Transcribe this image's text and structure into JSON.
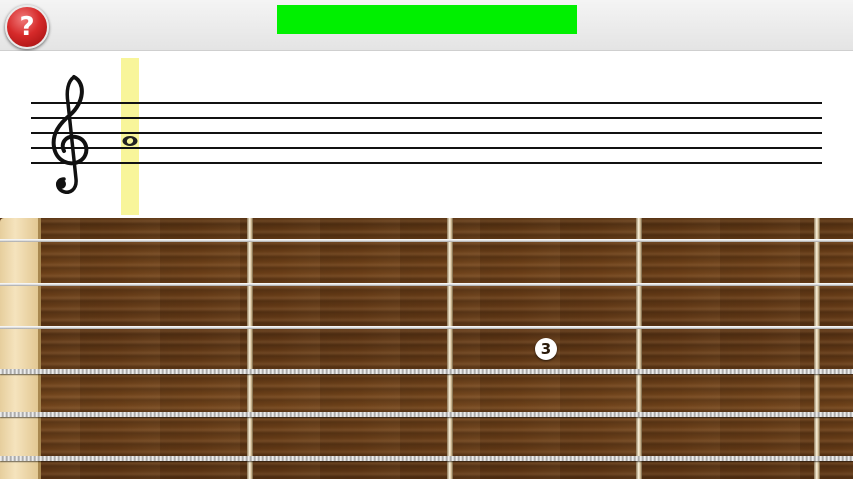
{
  "toolbar": {
    "help_label": "?",
    "progress_fraction": 1.0,
    "progress_color": "#00f000"
  },
  "staff": {
    "clef_icon": "treble-clef-icon",
    "note_icon": "whole-note-icon",
    "highlight_color": "#f8f59a"
  },
  "fretboard": {
    "finger_marker": {
      "label": "3",
      "string": 3,
      "fret": 3
    }
  }
}
